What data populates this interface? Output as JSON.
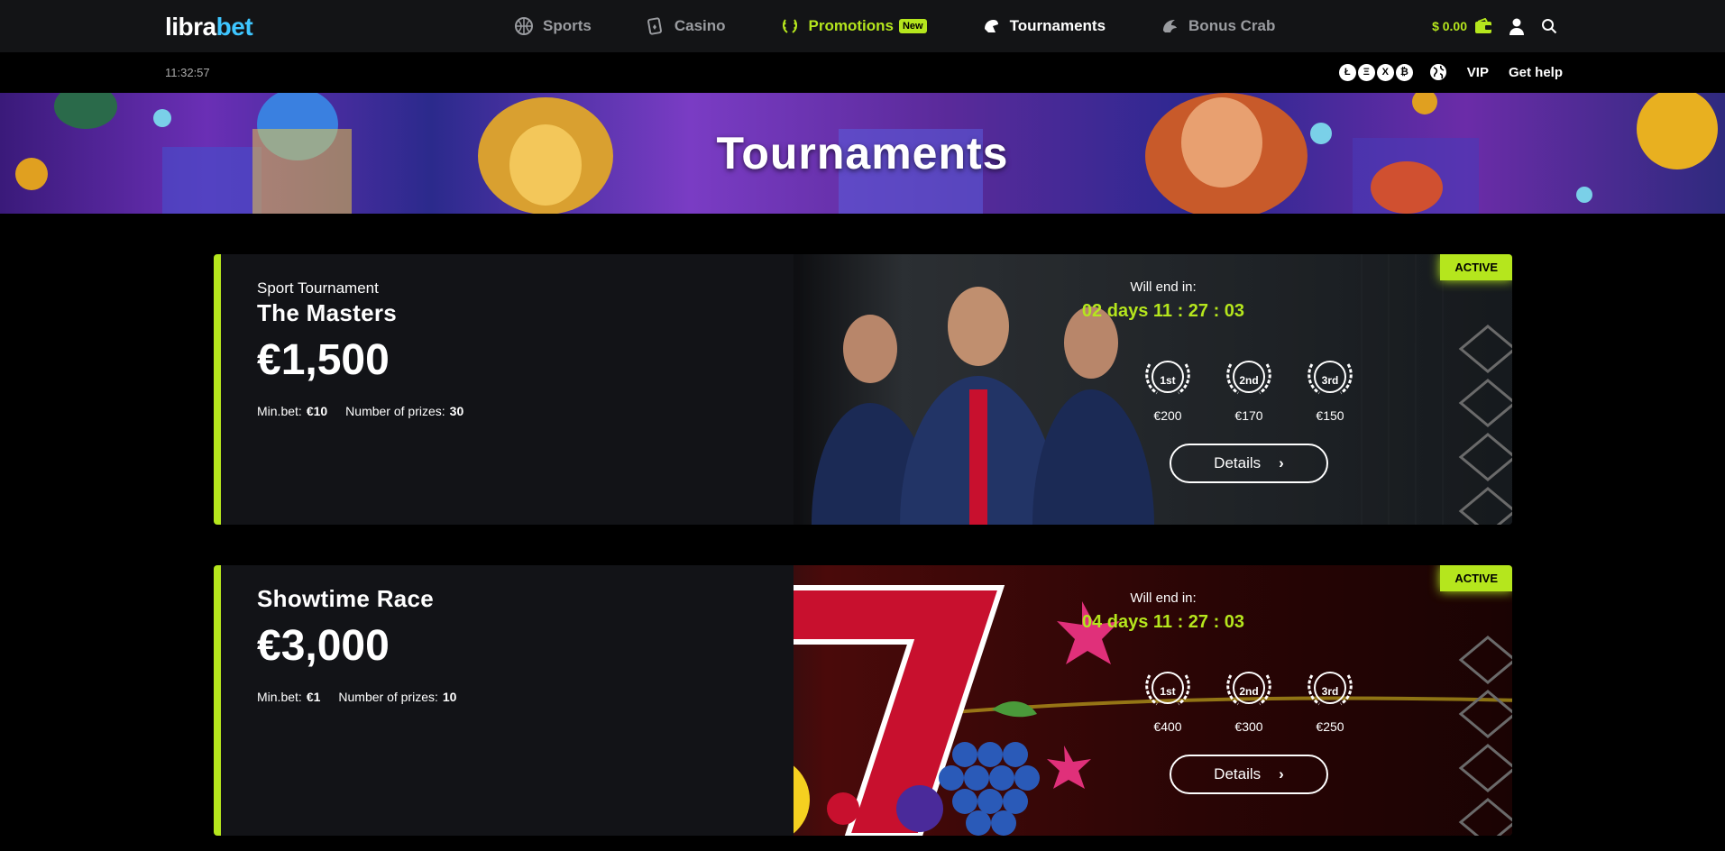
{
  "header": {
    "logo_part1": "libra",
    "logo_part2": "bet",
    "nav": [
      {
        "label": "Sports",
        "icon": "basketball-icon"
      },
      {
        "label": "Casino",
        "icon": "cards-icon"
      },
      {
        "label": "Promotions",
        "icon": "laurel-icon",
        "badge": "New"
      },
      {
        "label": "Tournaments",
        "icon": "helmet-icon"
      },
      {
        "label": "Bonus Crab",
        "icon": "crab-icon"
      }
    ],
    "balance": "$ 0.00"
  },
  "subbar": {
    "time": "11:32:57",
    "coins": [
      "Ł",
      "Ξ",
      "X",
      "₿"
    ],
    "vip": "VIP",
    "help": "Get help"
  },
  "hero": {
    "title": "Tournaments"
  },
  "tournaments": [
    {
      "subtitle": "Sport Tournament",
      "title": "The Masters",
      "prize": "€1,500",
      "min_bet_label": "Min.bet:",
      "min_bet": "€10",
      "prizes_label": "Number of prizes:",
      "prizes_count": "30",
      "status": "ACTIVE",
      "ends_label": "Will end in:",
      "ends_in": "02 days 11 : 27 : 03",
      "places": [
        {
          "place": "1st",
          "amount": "€200"
        },
        {
          "place": "2nd",
          "amount": "€170"
        },
        {
          "place": "3rd",
          "amount": "€150"
        }
      ],
      "details": "Details"
    },
    {
      "subtitle": "",
      "title": "Showtime Race",
      "prize": "€3,000",
      "min_bet_label": "Min.bet:",
      "min_bet": "€1",
      "prizes_label": "Number of prizes:",
      "prizes_count": "10",
      "status": "ACTIVE",
      "ends_label": "Will end in:",
      "ends_in": "04 days 11 : 27 : 03",
      "places": [
        {
          "place": "1st",
          "amount": "€400"
        },
        {
          "place": "2nd",
          "amount": "€300"
        },
        {
          "place": "3rd",
          "amount": "€250"
        }
      ],
      "details": "Details"
    }
  ],
  "colors": {
    "accent": "#b5e61d",
    "logo_blue": "#3ec6ff"
  }
}
